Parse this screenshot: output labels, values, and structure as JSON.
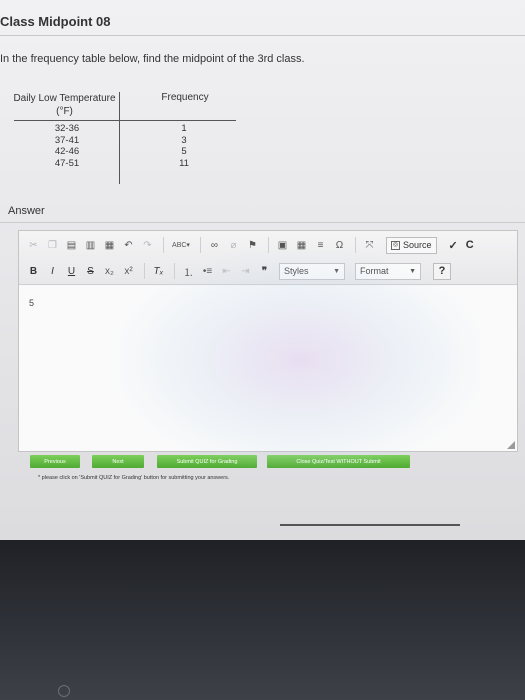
{
  "page": {
    "title": "Class Midpoint 08",
    "question": "In the frequency table below, find the midpoint of the 3rd class."
  },
  "table": {
    "headers": [
      "Daily Low Temperature (°F)",
      "Frequency"
    ],
    "rows": [
      {
        "temp": "32-36",
        "freq": "1"
      },
      {
        "temp": "37-41",
        "freq": "3"
      },
      {
        "temp": "42-46",
        "freq": "5"
      },
      {
        "temp": "47-51",
        "freq": "11"
      }
    ]
  },
  "answer": {
    "label": "Answer",
    "value": "5"
  },
  "toolbar": {
    "source_label": "Source",
    "styles_label": "Styles",
    "format_label": "Format",
    "help_label": "?",
    "check_label": "✓",
    "c_label": "C"
  },
  "buttons": {
    "previous": "Previous",
    "next": "Next",
    "submit": "Submit QUIZ for Grading",
    "close": "Close Quiz/Test WITHOUT Submit"
  },
  "note": "* please click on 'Submit QUIZ for Grading' button for submitting your answers."
}
